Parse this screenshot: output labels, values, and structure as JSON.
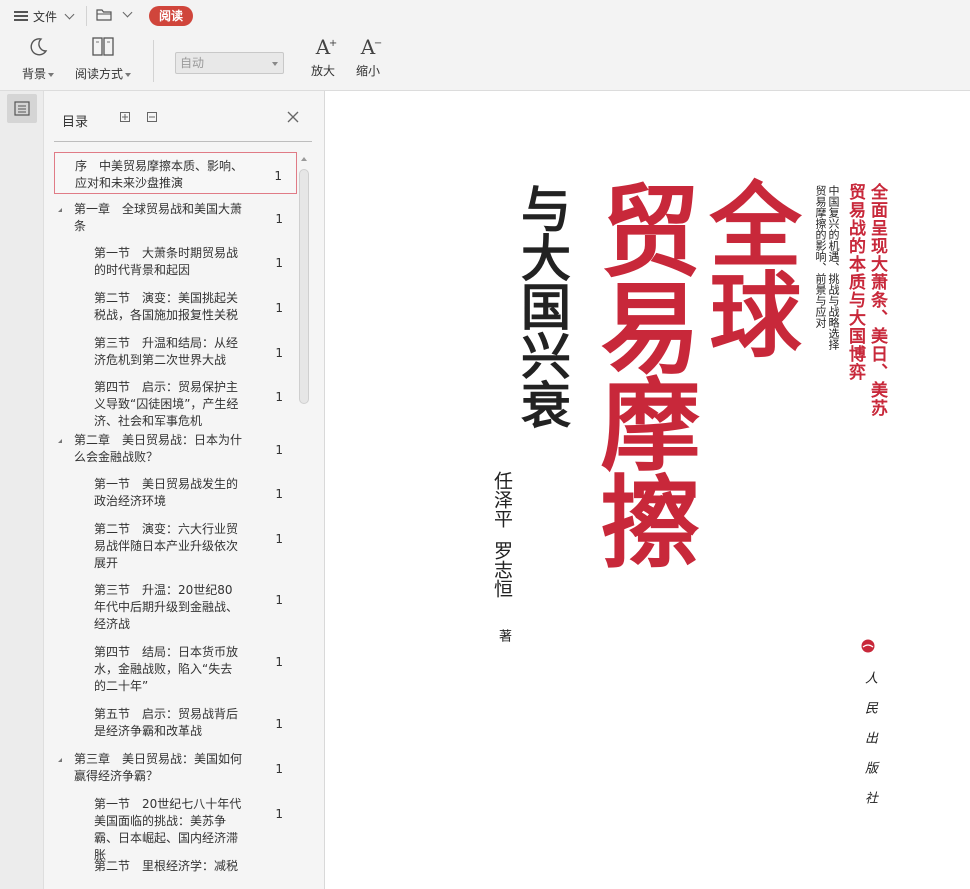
{
  "toolbar": {
    "menu_label": "文件",
    "read_label": "阅读",
    "background_label": "背景",
    "read_mode_label": "阅读方式",
    "zoom_select_value": "自动",
    "zoom_in_label": "放大",
    "zoom_out_label": "缩小",
    "zoom_in_glyph": "A",
    "zoom_in_sup": "+",
    "zoom_out_glyph": "A",
    "zoom_out_sup": "−"
  },
  "toc": {
    "title": "目录",
    "items": [
      {
        "text": "序　中美贸易摩擦本质、影响、应对和未来沙盘推演",
        "page": "1",
        "level": 0,
        "selected": true
      },
      {
        "text": "第一章　全球贸易战和美国大萧条",
        "page": "1",
        "level": 0,
        "expandable": true
      },
      {
        "text": "第一节　大萧条时期贸易战的时代背景和起因",
        "page": "1",
        "level": 1
      },
      {
        "text": "第二节　演变：美国挑起关税战，各国施加报复性关税",
        "page": "1",
        "level": 1
      },
      {
        "text": "第三节　升温和结局：从经济危机到第二次世界大战",
        "page": "1",
        "level": 1
      },
      {
        "text": "第四节　启示：贸易保护主义导致“囚徒困境”，产生经济、社会和军事危机",
        "page": "1",
        "level": 1
      },
      {
        "text": "第二章　美日贸易战：日本为什么会金融战败？",
        "page": "1",
        "level": 0,
        "expandable": true
      },
      {
        "text": "第一节　美日贸易战发生的政治经济环境",
        "page": "1",
        "level": 1
      },
      {
        "text": "第二节　演变：六大行业贸易战伴随日本产业升级依次展开",
        "page": "1",
        "level": 1
      },
      {
        "text": "第三节　升温：20世纪80年代中后期升级到金融战、经济战",
        "page": "1",
        "level": 1
      },
      {
        "text": "第四节　结局：日本货币放水，金融战败，陷入“失去的二十年”",
        "page": "1",
        "level": 1
      },
      {
        "text": "第五节　启示：贸易战背后是经济争霸和改革战",
        "page": "1",
        "level": 1
      },
      {
        "text": "第三章　美日贸易战：美国如何赢得经济争霸？",
        "page": "1",
        "level": 0,
        "expandable": true
      },
      {
        "text": "第一节　20世纪七八十年代美国面临的挑战：美苏争霸、日本崛起、国内经济滞胀",
        "page": "1",
        "level": 1
      },
      {
        "text": "第二节　里根经济学：减税",
        "page": "",
        "level": 1
      }
    ]
  },
  "cover": {
    "title_main_1": "全球",
    "title_main_2": "贸易摩擦",
    "title_sub": "与大国兴衰",
    "tagline_1": "全面呈现大萧条、美日、美苏",
    "tagline_2": "贸易战的本质与大国博弈",
    "small_1": "中国复兴的机遇、挑战与战略选择",
    "small_2": "贸易摩擦的影响、前景与应对",
    "author_1": "任泽平",
    "author_2": "罗志恒",
    "author_suffix": "著",
    "publisher": "人民出版社",
    "colors": {
      "red": "#c8283a",
      "dark": "#222222"
    }
  }
}
